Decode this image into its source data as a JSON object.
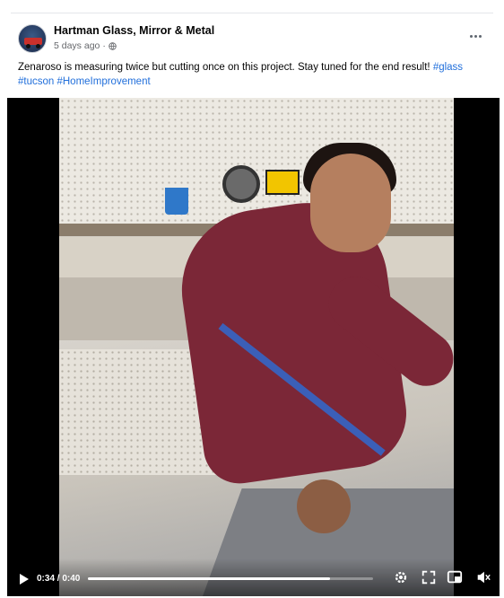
{
  "post": {
    "page_name": "Hartman Glass, Mirror & Metal",
    "time_ago": "5 days ago",
    "privacy_icon": "globe-icon",
    "more_icon": "more-options-icon",
    "caption_text": "Zenaroso is measuring twice but cutting once on this project. Stay tuned for the end result! ",
    "hashtags": [
      "#glass",
      "#tucson",
      "#HomeImprovement"
    ]
  },
  "video": {
    "current_time": "0:34",
    "duration": "0:40",
    "time_label": "0:34 / 0:40",
    "progress_fraction": 0.85,
    "icons": [
      "play-icon",
      "settings-icon",
      "fullscreen-icon",
      "picture-in-picture-icon",
      "mute-icon"
    ]
  },
  "colors": {
    "link": "#216fdb",
    "secondary_text": "#65676b",
    "shirt": "#7b2737",
    "controls": "#ffffff"
  }
}
